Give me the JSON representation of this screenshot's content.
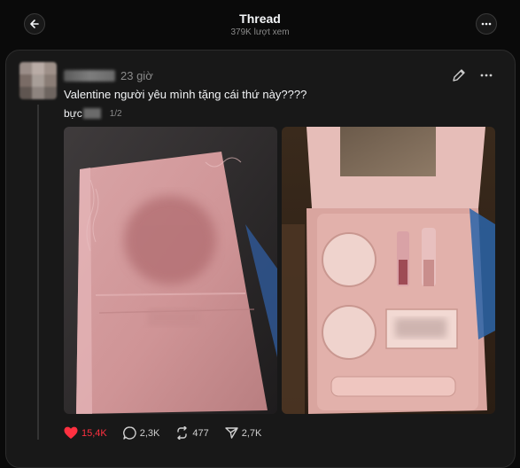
{
  "header": {
    "title": "Thread",
    "subtitle": "379K lượt xem"
  },
  "post": {
    "timestamp": "23 giờ",
    "text": "Valentine người yêu mình tặng cái thứ này????",
    "brand_prefix": "bực",
    "page_indicator": "1/2",
    "images": [
      {
        "icon": "closed-pink-gift-box-photo"
      },
      {
        "icon": "open-makeup-gift-set-photo"
      }
    ],
    "actions": {
      "likes": "15,4K",
      "comments": "2,3K",
      "reposts": "477",
      "shares": "2,7K"
    }
  },
  "colors": {
    "like_active": "#ff3040",
    "background": "#0a0a0a",
    "card": "#181818"
  }
}
